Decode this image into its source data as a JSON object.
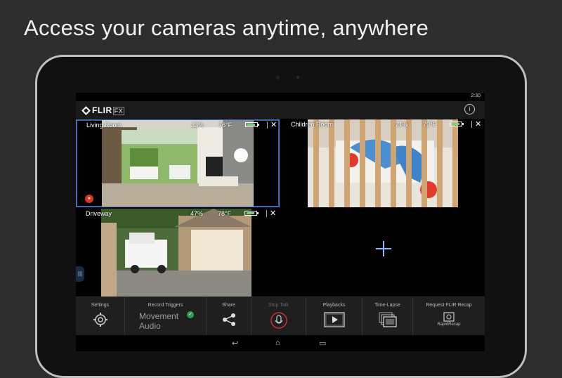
{
  "headline": "Access your cameras anytime, anywhere",
  "status_bar": {
    "time": "2:30"
  },
  "app": {
    "logo": "FLIR",
    "logo_suffix": "FX"
  },
  "cameras": [
    {
      "name": "Living Room",
      "humidity": "33%",
      "temperature": "76°F",
      "selected": true,
      "mic_active": true
    },
    {
      "name": "Children Room",
      "humidity": "21%",
      "temperature": "79°F",
      "selected": false
    },
    {
      "name": "Driveway",
      "humidity": "47%",
      "temperature": "78°F",
      "selected": false
    }
  ],
  "toolbar": {
    "settings": "Settings",
    "record_triggers": "Record Triggers",
    "trigger_movement": "Movement",
    "trigger_audio": "Audio",
    "share": "Share",
    "stop_talk": "Stop Talk",
    "playbacks": "Playbacks",
    "time_lapse": "Time-Lapse",
    "request_recap": "Request FLIR Recap",
    "rapid_recap": "RapidRecap"
  },
  "colors": {
    "accent": "#8fb3ff",
    "selected_border": "#4a7fd0",
    "check": "#2e9d4e",
    "mic": "#d32f2f"
  }
}
